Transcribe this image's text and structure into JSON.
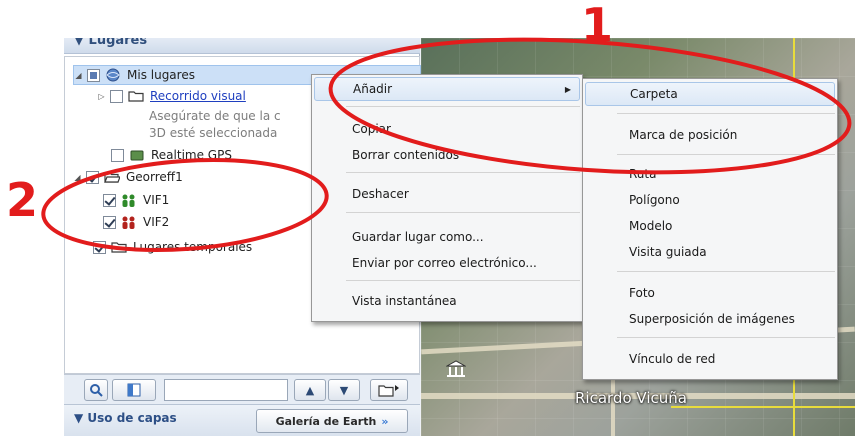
{
  "panel": {
    "header": "Lugares",
    "tree": {
      "my_places": "Mis lugares",
      "tour": "Recorrido visual",
      "tour_note_line1": "Asegúrate de que la c",
      "tour_note_line2": "3D esté seleccionada",
      "realtime": "Realtime GPS",
      "folder": "Georreff1",
      "item1": "VIF1",
      "item2": "VIF2",
      "temp": "Lugares temporales"
    }
  },
  "layers": {
    "label": "Uso de capas",
    "gallery_button": "Galería de Earth",
    "gallery_chevron": "»"
  },
  "map": {
    "road_label": "Ricardo Vicuña"
  },
  "context_menu": {
    "items": [
      {
        "label": "Añadir",
        "submenu": true
      },
      {
        "label": "Copiar"
      },
      {
        "label": "Borrar contenidos"
      },
      {
        "label": "Deshacer"
      },
      {
        "label": "Guardar lugar como..."
      },
      {
        "label": "Enviar por correo electrónico..."
      },
      {
        "label": "Vista instantánea"
      }
    ]
  },
  "submenu": {
    "items": [
      "Carpeta",
      "Marca de posición",
      "Ruta",
      "Polígono",
      "Modelo",
      "Visita guiada",
      "Foto",
      "Superposición de imágenes",
      "Vínculo de red"
    ]
  },
  "annotations": {
    "one": "1",
    "two": "2"
  },
  "colors": {
    "annotation": "#e21c1c",
    "link": "#1f3fbf",
    "selection": "#cce0f7"
  }
}
